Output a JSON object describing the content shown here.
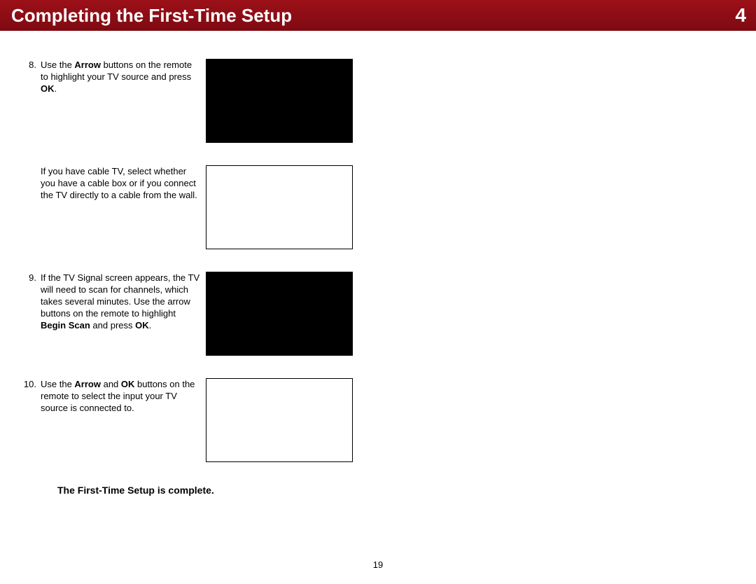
{
  "header": {
    "title": "Completing the First-Time Setup",
    "chapter": "4"
  },
  "steps": {
    "s8": {
      "num": "8.",
      "a": "Use the ",
      "b": "Arrow",
      "c": " buttons on the remote to highlight your TV source and press ",
      "d": "OK",
      "e": "."
    },
    "s8sub": {
      "text": "If you have cable TV, select whether you have a cable box or if you connect the TV directly to a cable from the wall."
    },
    "s9": {
      "num": "9.",
      "a": "If the TV Signal screen appears, the TV will need to scan for channels, which takes several minutes. Use the arrow buttons on the remote to highlight ",
      "b": "Begin Scan",
      "c": " and press ",
      "d": "OK",
      "e": "."
    },
    "s10": {
      "num": "10.",
      "a": "Use the ",
      "b": "Arrow",
      "c": " and ",
      "d": "OK",
      "e": " buttons on the remote to select the input your TV source is connected to."
    }
  },
  "complete": "The First-Time Setup is complete.",
  "page_number": "19"
}
